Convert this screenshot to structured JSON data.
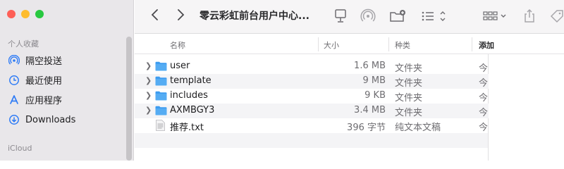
{
  "window": {
    "title": "零云彩虹前台用户中心..."
  },
  "sidebar": {
    "favorites_title": "个人收藏",
    "items": [
      {
        "label": "隔空投送",
        "icon": "airdrop-icon"
      },
      {
        "label": "最近使用",
        "icon": "clock-icon"
      },
      {
        "label": "应用程序",
        "icon": "applications-icon"
      },
      {
        "label": "Downloads",
        "icon": "downloads-icon"
      }
    ],
    "icloud_title": "iCloud"
  },
  "columns": {
    "name": "名称",
    "size": "大小",
    "kind": "种类",
    "date": "添加"
  },
  "files": [
    {
      "name": "user",
      "size": "1.6 MB",
      "kind": "文件夹",
      "date": "今",
      "type": "folder"
    },
    {
      "name": "template",
      "size": "9 MB",
      "kind": "文件夹",
      "date": "今",
      "type": "folder"
    },
    {
      "name": "includes",
      "size": "9 KB",
      "kind": "文件夹",
      "date": "今",
      "type": "folder"
    },
    {
      "name": "AXMBGY3",
      "size": "3.4 MB",
      "kind": "文件夹",
      "date": "今",
      "type": "folder"
    },
    {
      "name": "推荐.txt",
      "size": "396 字节",
      "kind": "纯文本文稿",
      "date": "今",
      "type": "text"
    }
  ],
  "colors": {
    "accent": "#2f7cf6",
    "folder": "#3d9cf0",
    "sidebar_bg": "#e9e7ea"
  }
}
